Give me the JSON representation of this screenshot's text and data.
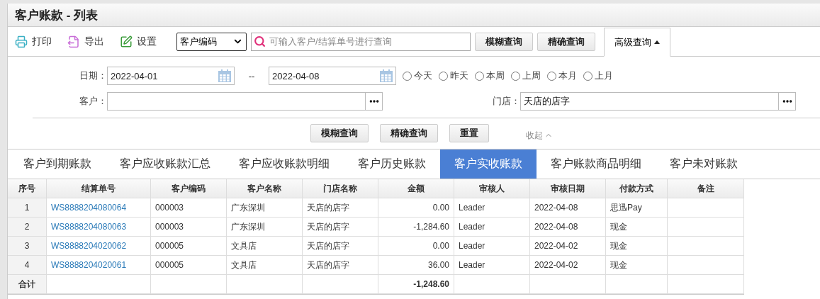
{
  "title": "客户账款 - 列表",
  "toolbar": {
    "actions": [
      {
        "kind": "print",
        "label": "打印"
      },
      {
        "kind": "export",
        "label": "导出"
      },
      {
        "kind": "settings",
        "label": "设置"
      }
    ],
    "field_select": {
      "value": "客户编码"
    },
    "search": {
      "placeholder": "可输入客户/结算单号进行查询"
    },
    "buttons": [
      "模糊查询",
      "精确查询"
    ],
    "advanced": {
      "label": "高级查询",
      "expanded": true
    }
  },
  "filters": {
    "date_label": "日期：",
    "date_from": "2022-04-01",
    "date_separator": "--",
    "date_to": "2022-04-08",
    "quick_ranges": [
      {
        "label": "今天",
        "selected": false
      },
      {
        "label": "昨天",
        "selected": false
      },
      {
        "label": "本周",
        "selected": false
      },
      {
        "label": "上周",
        "selected": false
      },
      {
        "label": "本月",
        "selected": false
      },
      {
        "label": "上月",
        "selected": false
      }
    ],
    "customer_label": "客户：",
    "store_label": "门店：",
    "store_value": "天店的店字",
    "buttons": [
      "模糊查询",
      "精确查询",
      "重置"
    ],
    "collapse": "收起"
  },
  "tabs": [
    {
      "label": "客户到期账款",
      "selected": false
    },
    {
      "label": "客户应收账款汇总",
      "selected": false
    },
    {
      "label": "客户应收账款明细",
      "selected": false
    },
    {
      "label": "客户历史账款",
      "selected": false
    },
    {
      "label": "客户实收账款",
      "selected": true
    },
    {
      "label": "客户账款商品明细",
      "selected": false
    },
    {
      "label": "客户未对账款",
      "selected": false
    }
  ],
  "table": {
    "columns": [
      "序号",
      "结算单号",
      "客户编码",
      "客户名称",
      "门店名称",
      "金额",
      "审核人",
      "审核日期",
      "付款方式",
      "备注"
    ],
    "rows": [
      [
        "1",
        "WS8888204080064",
        "000003",
        "广东深圳",
        "天店的店字",
        "0.00",
        "Leader",
        "2022-04-08",
        "思迅Pay"
      ],
      [
        "2",
        "WS8888204080063",
        "000003",
        "广东深圳",
        "天店的店字",
        "-1,284.60",
        "Leader",
        "2022-04-08",
        "现金"
      ],
      [
        "3",
        "WS8888204020062",
        "000005",
        "文具店",
        "天店的店字",
        "0.00",
        "Leader",
        "2022-04-02",
        "现金"
      ],
      [
        "4",
        "WS8888204020061",
        "000005",
        "文具店",
        "天店的店字",
        "36.00",
        "Leader",
        "2022-04-02",
        "现金"
      ]
    ],
    "total": {
      "label": "合计",
      "amount": "-1,248.60"
    }
  }
}
